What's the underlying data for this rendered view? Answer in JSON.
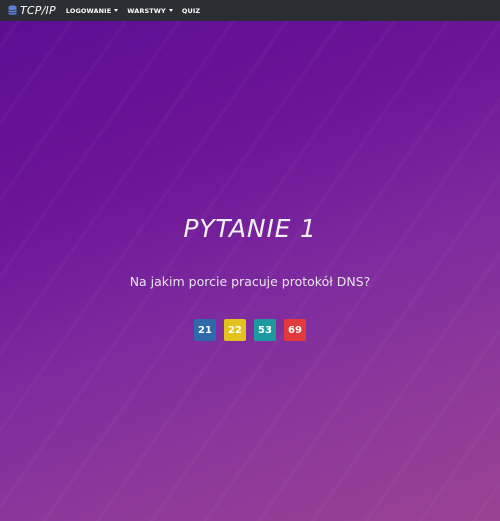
{
  "navbar": {
    "brand_text": "TCP/IP",
    "brand_icon": "database-icon",
    "items": [
      {
        "label": "LOGOWANIE",
        "dropdown": true
      },
      {
        "label": "WARSTWY",
        "dropdown": true
      },
      {
        "label": "QUIZ",
        "dropdown": false
      }
    ]
  },
  "quiz": {
    "title": "PYTANIE 1",
    "question": "Na jakim porcie pracuje protokół DNS?",
    "answers": [
      {
        "label": "21",
        "color": "#2e6aaa"
      },
      {
        "label": "22",
        "color": "#e2c21c"
      },
      {
        "label": "53",
        "color": "#1d9aa0"
      },
      {
        "label": "69",
        "color": "#e23a3c"
      }
    ]
  },
  "colors": {
    "navbar_bg": "#2b2f33",
    "brand_icon": "#5b7fd6",
    "hero_start": "#5d0e93",
    "hero_end": "#9a4293"
  }
}
